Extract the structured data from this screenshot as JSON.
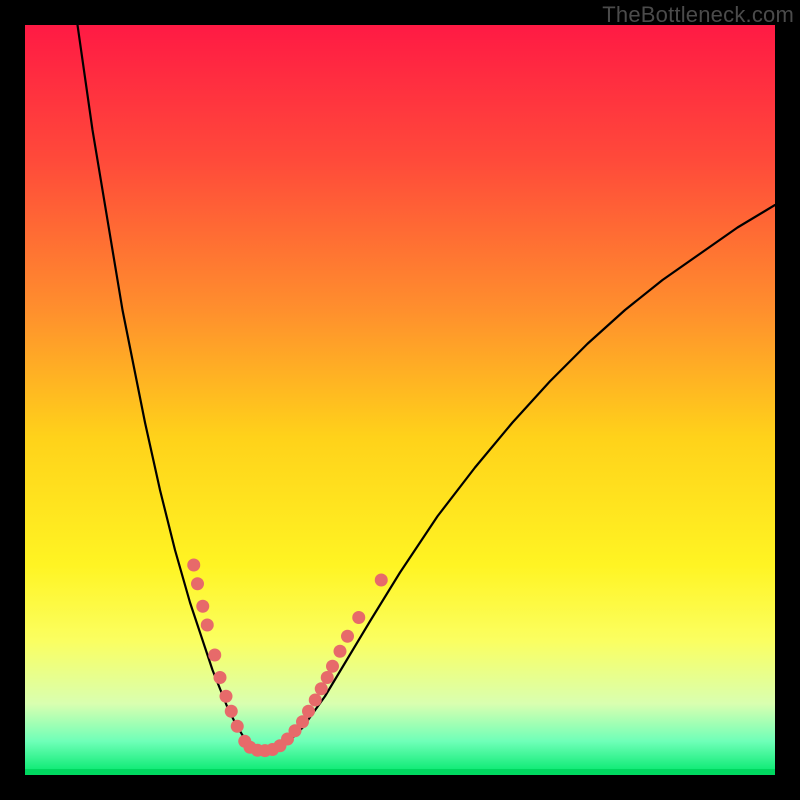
{
  "watermark": "TheBottleneck.com",
  "chart_data": {
    "type": "line",
    "title": "",
    "xlabel": "",
    "ylabel": "",
    "xlim": [
      0,
      100
    ],
    "ylim": [
      0,
      100
    ],
    "gradient_stops": [
      {
        "offset": 0.0,
        "color": "#ff1a44"
      },
      {
        "offset": 0.18,
        "color": "#ff4a3a"
      },
      {
        "offset": 0.38,
        "color": "#ff8f2d"
      },
      {
        "offset": 0.55,
        "color": "#ffd21a"
      },
      {
        "offset": 0.72,
        "color": "#fff423"
      },
      {
        "offset": 0.82,
        "color": "#fbff60"
      },
      {
        "offset": 0.905,
        "color": "#d9ffb0"
      },
      {
        "offset": 0.955,
        "color": "#6fffb8"
      },
      {
        "offset": 1.0,
        "color": "#00e86b"
      }
    ],
    "series": [
      {
        "name": "bottleneck-curve",
        "color": "#000000",
        "width": 2.2,
        "x": [
          7,
          8,
          9,
          10,
          11,
          12,
          13,
          14,
          15,
          16,
          17,
          18,
          19,
          20,
          21,
          22,
          23,
          24,
          25,
          26,
          27,
          28,
          29,
          30,
          31,
          33,
          35,
          37,
          40,
          43,
          46,
          50,
          55,
          60,
          65,
          70,
          75,
          80,
          85,
          90,
          95,
          100
        ],
        "y": [
          100,
          93,
          86,
          80,
          74,
          68,
          62,
          57,
          52,
          47,
          42.5,
          38,
          34,
          30,
          26.5,
          23,
          20,
          17,
          14,
          11.5,
          9,
          7,
          5.3,
          4,
          3.4,
          3.3,
          4.3,
          6.3,
          10.5,
          15.5,
          20.5,
          27,
          34.5,
          41,
          47,
          52.5,
          57.5,
          62,
          66,
          69.5,
          73,
          76
        ]
      }
    ],
    "scatter": {
      "name": "highlight-dots",
      "color": "#e76a6a",
      "radius": 6.5,
      "points": [
        {
          "x": 22.5,
          "y": 28.0
        },
        {
          "x": 23.0,
          "y": 25.5
        },
        {
          "x": 23.7,
          "y": 22.5
        },
        {
          "x": 24.3,
          "y": 20.0
        },
        {
          "x": 25.3,
          "y": 16.0
        },
        {
          "x": 26.0,
          "y": 13.0
        },
        {
          "x": 26.8,
          "y": 10.5
        },
        {
          "x": 27.5,
          "y": 8.5
        },
        {
          "x": 28.3,
          "y": 6.5
        },
        {
          "x": 29.3,
          "y": 4.5
        },
        {
          "x": 30.0,
          "y": 3.7
        },
        {
          "x": 31.0,
          "y": 3.3
        },
        {
          "x": 32.0,
          "y": 3.25
        },
        {
          "x": 33.0,
          "y": 3.4
        },
        {
          "x": 34.0,
          "y": 3.9
        },
        {
          "x": 35.0,
          "y": 4.8
        },
        {
          "x": 36.0,
          "y": 5.9
        },
        {
          "x": 37.0,
          "y": 7.1
        },
        {
          "x": 37.8,
          "y": 8.5
        },
        {
          "x": 38.7,
          "y": 10.0
        },
        {
          "x": 39.5,
          "y": 11.5
        },
        {
          "x": 40.3,
          "y": 13.0
        },
        {
          "x": 41.0,
          "y": 14.5
        },
        {
          "x": 42.0,
          "y": 16.5
        },
        {
          "x": 43.0,
          "y": 18.5
        },
        {
          "x": 44.5,
          "y": 21.0
        },
        {
          "x": 47.5,
          "y": 26.0
        }
      ]
    }
  }
}
